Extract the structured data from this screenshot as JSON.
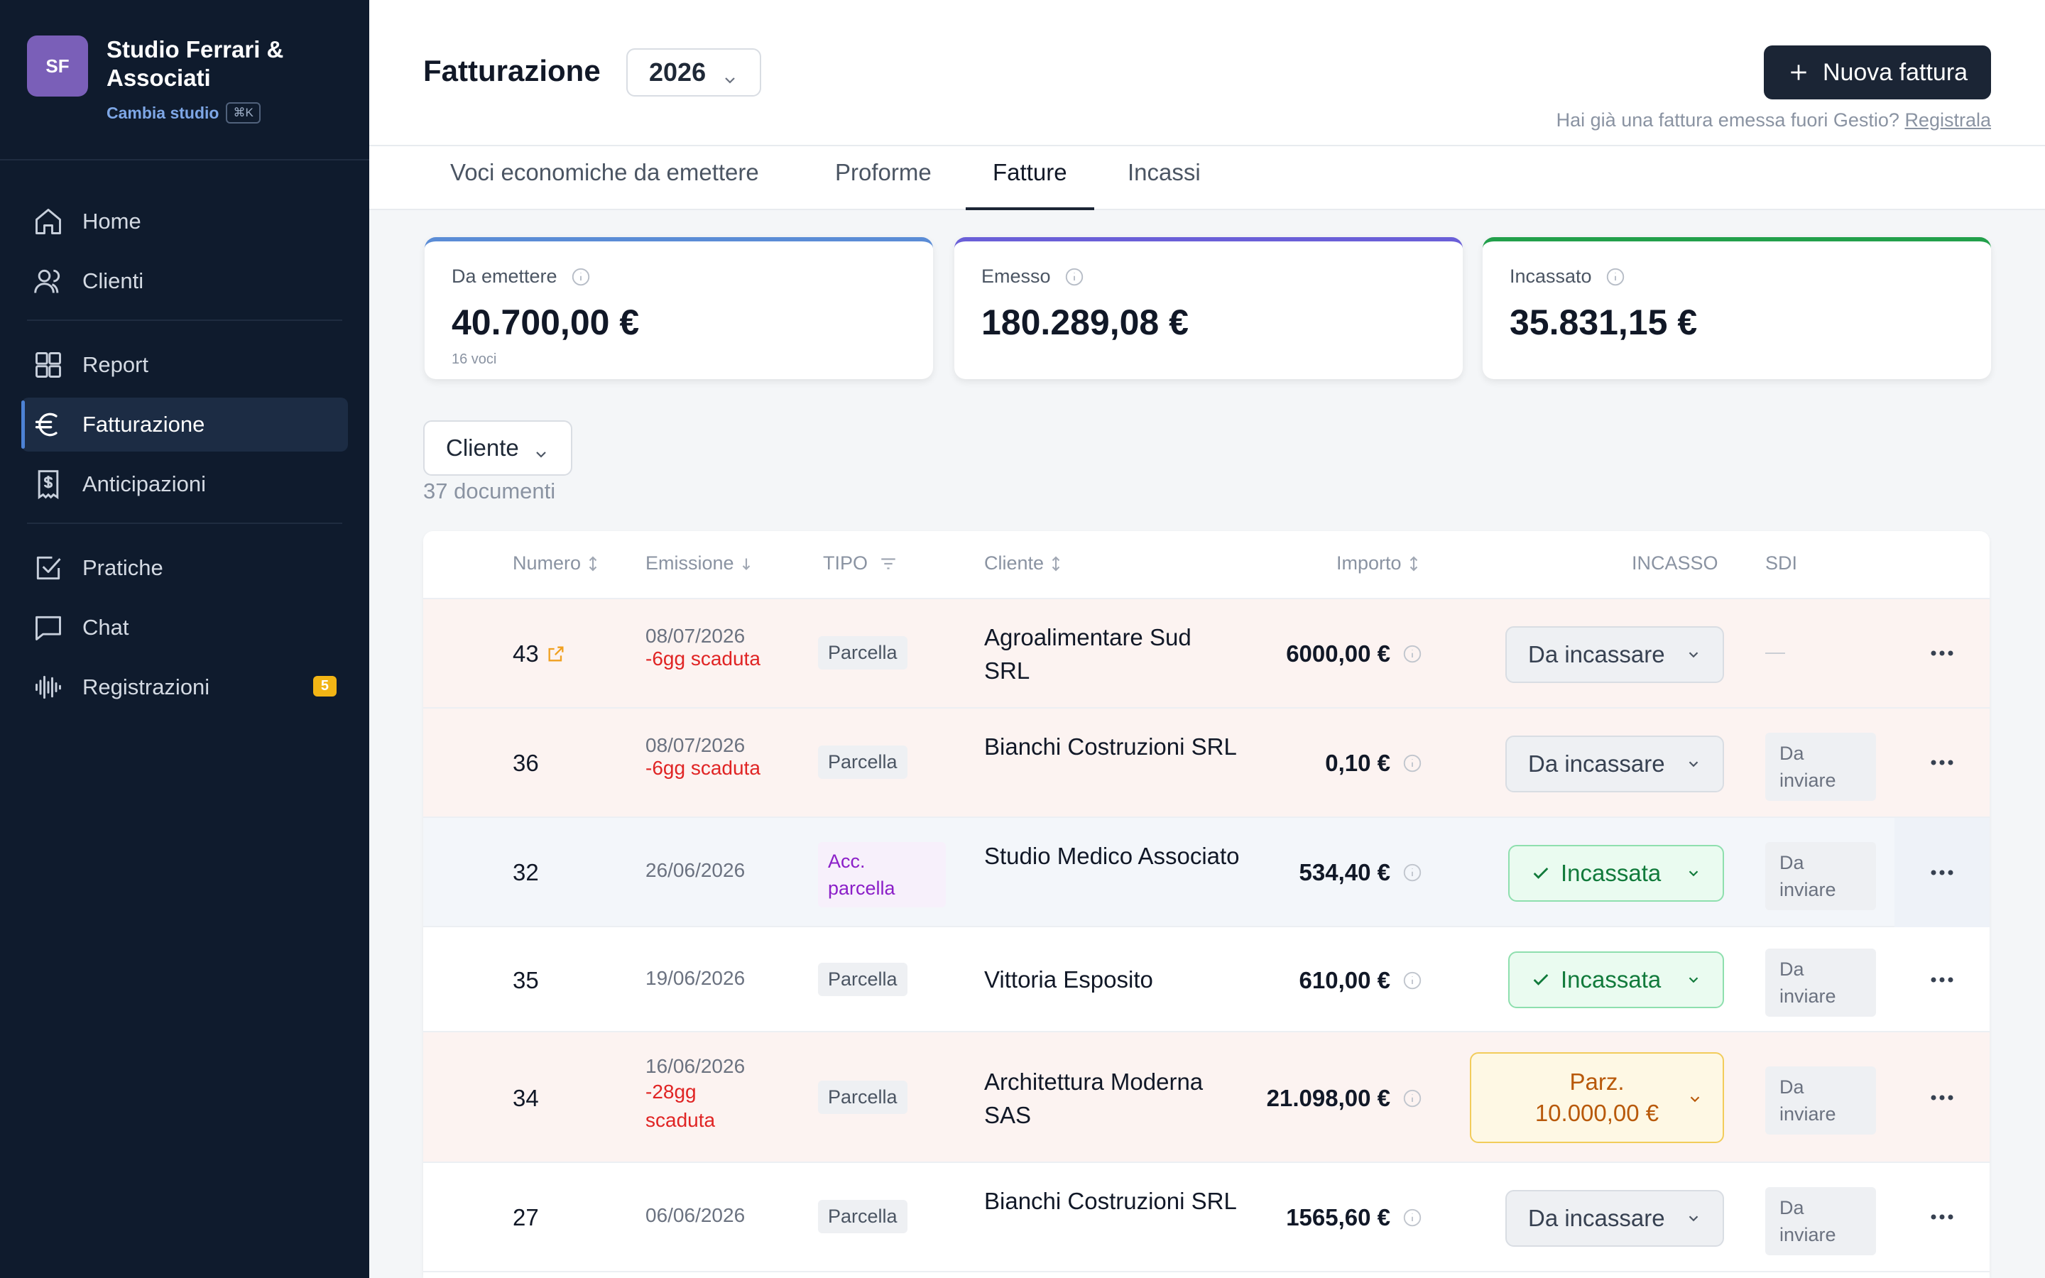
{
  "sidebar": {
    "brand_initials": "SF",
    "brand_name": "Studio Ferrari & Associati",
    "switch_label": "Cambia studio",
    "switch_shortcut": "⌘K",
    "items": [
      {
        "label": "Home",
        "icon": "home-icon"
      },
      {
        "label": "Clienti",
        "icon": "users-icon"
      },
      {
        "label": "Report",
        "icon": "grid-icon"
      },
      {
        "label": "Fatturazione",
        "icon": "euro-icon"
      },
      {
        "label": "Anticipazioni",
        "icon": "receipt-icon"
      },
      {
        "label": "Pratiche",
        "icon": "checkbox-icon"
      },
      {
        "label": "Chat",
        "icon": "chat-icon"
      },
      {
        "label": "Registrazioni",
        "icon": "audio-icon",
        "badge": "5"
      }
    ]
  },
  "header": {
    "title": "Fatturazione",
    "year": "2026",
    "new_button": "Nuova fattura",
    "note_text": "Hai già una fattura emessa fuori Gestio?",
    "note_link": "Registrala"
  },
  "tabs": [
    "Voci economiche da emettere",
    "Proforme",
    "Fatture",
    "Incassi"
  ],
  "cards": [
    {
      "label": "Da emettere",
      "value": "40.700,00 €",
      "sub": "16 voci",
      "accent": "#5a8cd6"
    },
    {
      "label": "Emesso",
      "value": "180.289,08 €",
      "sub": "",
      "accent": "#6a5fd8"
    },
    {
      "label": "Incassato",
      "value": "35.831,15 €",
      "sub": "",
      "accent": "#22a04b"
    }
  ],
  "filter": {
    "label": "Cliente",
    "count": "37 documenti"
  },
  "table": {
    "headers": {
      "numero": "Numero",
      "emissione": "Emissione",
      "tipo": "TIPO",
      "cliente": "Cliente",
      "importo": "Importo",
      "incasso": "INCASSO",
      "sdi": "SDI"
    },
    "rows": [
      {
        "numero": "43",
        "date": "08/07/2026",
        "overdue": "-6gg scaduta",
        "tipo": "Parcella",
        "cliente": "Agroalimentare Sud SRL",
        "importo": "6000,00 €",
        "incasso": "Da incassare",
        "sdi": "—"
      },
      {
        "numero": "36",
        "date": "08/07/2026",
        "overdue": "-6gg scaduta",
        "tipo": "Parcella",
        "cliente": "Bianchi Costruzioni SRL",
        "importo": "0,10 €",
        "incasso": "Da incassare",
        "sdi": "Da inviare"
      },
      {
        "numero": "32",
        "date": "26/06/2026",
        "overdue": "",
        "tipo": "Acc. parcella",
        "cliente": "Studio Medico Associato",
        "importo": "534,40 €",
        "incasso": "Incassata",
        "sdi": "Da inviare"
      },
      {
        "numero": "35",
        "date": "19/06/2026",
        "overdue": "",
        "tipo": "Parcella",
        "cliente": "Vittoria Esposito",
        "importo": "610,00 €",
        "incasso": "Incassata",
        "sdi": "Da inviare"
      },
      {
        "numero": "34",
        "date": "16/06/2026",
        "overdue": "-28gg scaduta",
        "tipo": "Parcella",
        "cliente": "Architettura Moderna SAS",
        "importo": "21.098,00 €",
        "incasso": "Parz. 10.000,00 €",
        "sdi": "Da inviare"
      },
      {
        "numero": "27",
        "date": "06/06/2026",
        "overdue": "",
        "tipo": "Parcella",
        "cliente": "Bianchi Costruzioni SRL",
        "importo": "1565,60 €",
        "incasso": "Da incassare",
        "sdi": "Da inviare"
      }
    ]
  }
}
